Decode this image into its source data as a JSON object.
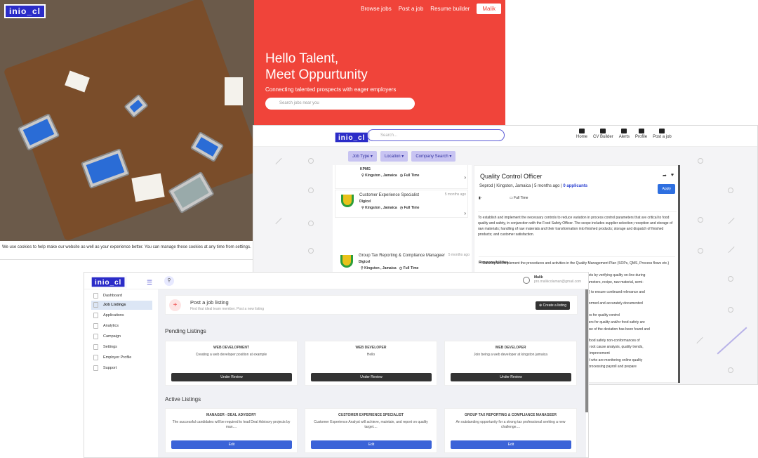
{
  "brand": {
    "logo_text": "inio_cl"
  },
  "landing": {
    "nav": {
      "browse": "Browse jobs",
      "post": "Post a job",
      "resume": "Resume builder",
      "user": "Malik"
    },
    "headline_1": "Hello Talent,",
    "headline_2": "Meet Oppurtunity",
    "subtitle": "Connecting talented prospects with eager employers",
    "search_placeholder": "Search jobs near you",
    "cookie_text": "We use cookies to help make our website as well as your experience better. You can manage these cookies at any time from settings."
  },
  "jobboard": {
    "search_placeholder": "Search...",
    "nav": [
      {
        "label": "Home",
        "icon": "home-icon"
      },
      {
        "label": "CV Builder",
        "icon": "document-icon"
      },
      {
        "label": "Alerts",
        "icon": "bell-icon"
      },
      {
        "label": "Profile",
        "icon": "user-icon"
      },
      {
        "label": "Post a job",
        "icon": "briefcase-icon"
      }
    ],
    "filters": [
      "Job Type",
      "Location",
      "Company Search"
    ],
    "list": [
      {
        "title": "",
        "company": "KPMG",
        "location": "Kingston , Jamaica",
        "type": "Full Time",
        "ago": ""
      },
      {
        "title": "Customer Experience Specialist",
        "company": "Digicel",
        "location": "Kingston , Jamaica",
        "type": "Full Time",
        "ago": "5 months ago"
      },
      {
        "title": "Group Tax Reporting & Compliance Manageer",
        "company": "Digicel",
        "location": "Kingston , Jamaica",
        "type": "Full Time",
        "ago": "5 months ago"
      }
    ],
    "detail": {
      "title": "Quality Control Officer",
      "meta": "Seprod | Kingston, Jamaica | 5 months ago |",
      "applicants": "0 applicants",
      "apply": "Apply",
      "salary": "-",
      "type": "Full Time",
      "description": "To establish and implement the necessary controls to reduce variation in process control parameters that are critical to food quality and safety, in conjunction with the Food Safety Officer. The scope includes supplier selection; reception and storage of raw materials; handling of raw materials and their transformation into finished products; storage and dispatch of finished products; and customer satisfaction.",
      "responsibilities_heading": "Responsibilities",
      "bullets": [
        "Develop and implement the procedures and activities in the Quality Management Plan (SOPs, QMS, Process flows etc.)",
        "products by verifying quality on-line during",
        "g parameters, recipe, raw material, semi-",
        "(QMS) to ensure continued relevance and",
        "e performed and accurately documented",
        "ariables for quality control",
        "rameters for quality and/or food safety are",
        "ot cause of the deviation has been found and",
        "nd/or food safety non-conformances of",
        "ted to root cause analysis, quality trends,",
        "es for improvement",
        "sonnel who are monitoring online quality",
        "eets, processing payroll and prepare"
      ]
    }
  },
  "dashboard": {
    "user_name": "Malik",
    "user_email": "pro.malikcolaman@gmail.com",
    "sidebar": [
      "Dashboard",
      "Job Listings",
      "Applications",
      "Analytics",
      "Campaign",
      "Settings",
      "Employer Profile",
      "Support"
    ],
    "post": {
      "title": "Post a job listing",
      "subtitle": "Find that ideal team member. Post a new listing",
      "button": "Create a listing"
    },
    "pending_heading": "Pending Listings",
    "active_heading": "Active Listings",
    "pending": [
      {
        "title": "WEB DEVELOPMENT",
        "desc": "Creating a web developer position at example",
        "btn": "Under Review"
      },
      {
        "title": "WEB DEVELOPER",
        "desc": "Hello",
        "btn": "Under Review"
      },
      {
        "title": "WEB DEVELOPER",
        "desc": "Join being a web developer at kingston jamaica",
        "btn": "Under Review"
      }
    ],
    "active": [
      {
        "title": "MANAGER - DEAL ADVISORY",
        "desc": "The successful candidates will be required to lead Deal Advisory projects by man....",
        "btn": "Edit"
      },
      {
        "title": "CUSTOMER EXPERIENCE SPECIALIST",
        "desc": "Customer Experience Analyst will achieve, maintain, and report on quality target....",
        "btn": "Edit"
      },
      {
        "title": "GROUP TAX REPORTING & COMPLIANCE MANAGEER",
        "desc": "An outstanding opportunity for a strong tax professional seeking a new challenge....",
        "btn": "Edit"
      }
    ]
  },
  "colors": {
    "brand": "#2b2cc8",
    "hero": "#f0443a",
    "edit": "#3b63d8",
    "review": "#333333"
  }
}
